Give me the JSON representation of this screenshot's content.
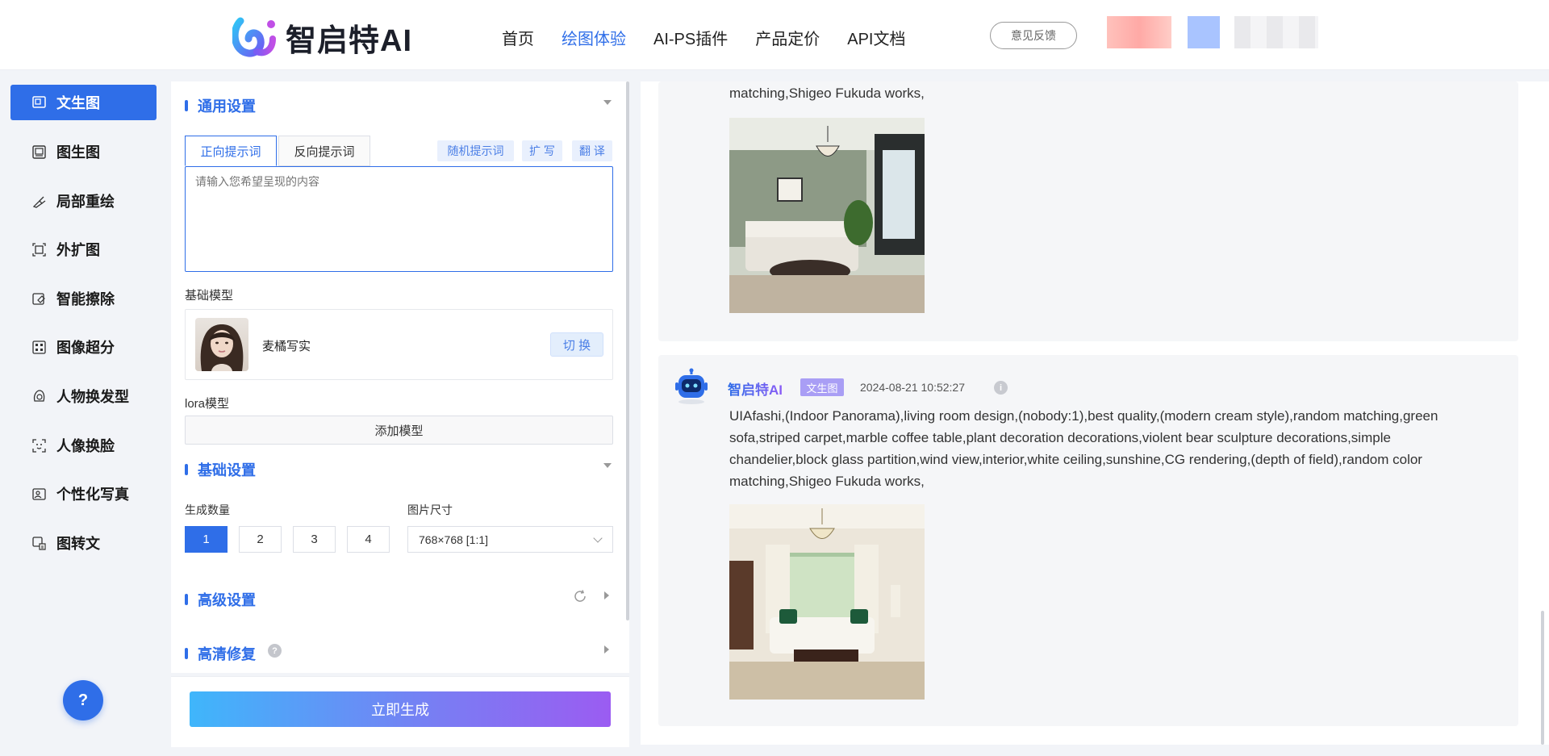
{
  "header": {
    "brand": "智启特AI",
    "nav": [
      "首页",
      "绘图体验",
      "AI-PS插件",
      "产品定价",
      "API文档"
    ],
    "feedback_label": "意见反馈"
  },
  "sidebar": {
    "items": [
      {
        "label": "文生图",
        "icon": "text-image-icon"
      },
      {
        "label": "图生图",
        "icon": "image-image-icon"
      },
      {
        "label": "局部重绘",
        "icon": "brush-icon"
      },
      {
        "label": "外扩图",
        "icon": "expand-icon"
      },
      {
        "label": "智能擦除",
        "icon": "eraser-icon"
      },
      {
        "label": "图像超分",
        "icon": "upscale-icon"
      },
      {
        "label": "人物换发型",
        "icon": "hairstyle-icon"
      },
      {
        "label": "人像换脸",
        "icon": "face-swap-icon"
      },
      {
        "label": "个性化写真",
        "icon": "portrait-icon"
      },
      {
        "label": "图转文",
        "icon": "image-to-text-icon"
      }
    ],
    "help": "?"
  },
  "panel": {
    "general_title": "通用设置",
    "tab_positive": "正向提示词",
    "tab_negative": "反向提示词",
    "btn_random": "随机提示词",
    "btn_expand": "扩 写",
    "btn_translate": "翻 译",
    "prompt_placeholder": "请输入您希望呈现的内容",
    "base_model_label": "基础模型",
    "model_name": "麦橘写实",
    "switch_label": "切 换",
    "lora_label": "lora模型",
    "add_model": "添加模型",
    "basic_title": "基础设置",
    "count_label": "生成数量",
    "counts": [
      "1",
      "2",
      "3",
      "4"
    ],
    "size_label": "图片尺寸",
    "size_value": "768×768 [1:1]",
    "advanced_title": "高级设置",
    "hires_title": "高清修复",
    "hires_help": "?",
    "generate": "立即生成"
  },
  "results": {
    "top_text_tail": "matching,Shigeo Fukuda works,",
    "author": "智启特AI",
    "tag": "文生图",
    "time": "2024-08-21 10:52:27",
    "info": "i",
    "prompt": "UIAfashi,(Indoor Panorama),living room design,(nobody:1),best quality,(modern cream style),random matching,green sofa,striped carpet,marble coffee table,plant decoration decorations,violent bear sculpture decorations,simple chandelier,block glass partition,wind view,interior,white ceiling,sunshine,CG rendering,(depth of field),random color matching,Shigeo Fukuda works,"
  }
}
